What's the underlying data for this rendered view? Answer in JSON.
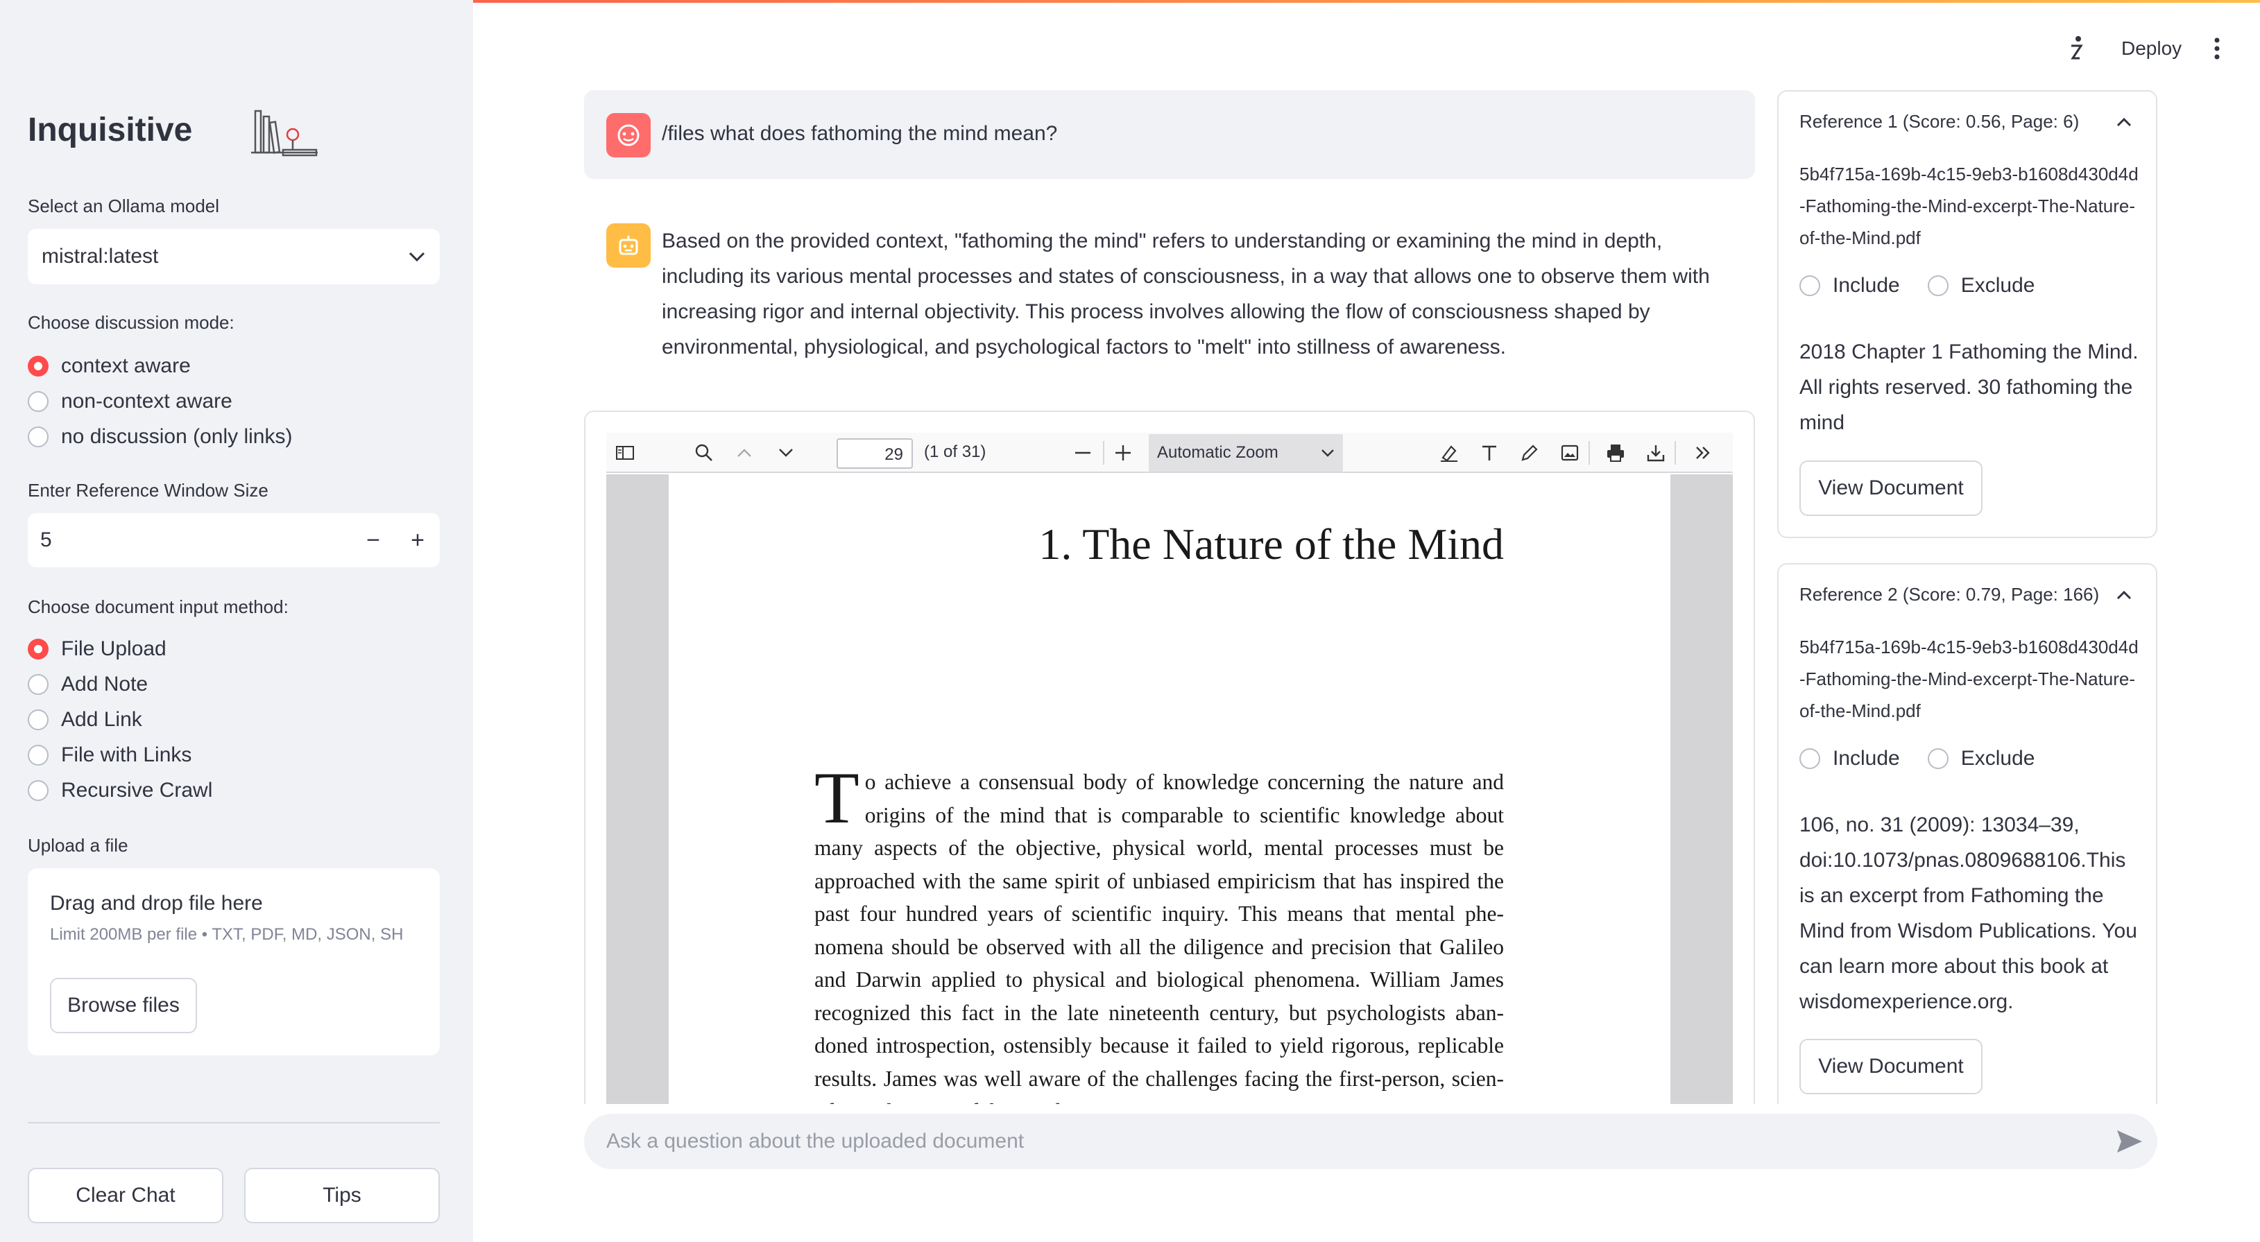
{
  "sidebar": {
    "title": "Inquisitive",
    "model_label": "Select an Ollama model",
    "model_value": "mistral:latest",
    "mode_label": "Choose discussion mode:",
    "modes": [
      {
        "label": "context aware",
        "selected": true
      },
      {
        "label": "non-context aware",
        "selected": false
      },
      {
        "label": "no discussion (only links)",
        "selected": false
      }
    ],
    "window_label": "Enter Reference Window Size",
    "window_value": "5",
    "input_method_label": "Choose document input method:",
    "input_methods": [
      {
        "label": "File Upload",
        "selected": true
      },
      {
        "label": "Add Note",
        "selected": false
      },
      {
        "label": "Add Link",
        "selected": false
      },
      {
        "label": "File with Links",
        "selected": false
      },
      {
        "label": "Recursive Crawl",
        "selected": false
      }
    ],
    "upload_label": "Upload a file",
    "upload_drag": "Drag and drop file here",
    "upload_limit": "Limit 200MB per file • TXT, PDF, MD, JSON, SH",
    "browse_label": "Browse files",
    "clear_label": "Clear Chat",
    "tips_label": "Tips"
  },
  "topbar": {
    "deploy_label": "Deploy"
  },
  "chat": {
    "user_message": "/files what does fathoming the mind mean?",
    "bot_message": "Based on the provided context, \"fathoming the mind\" refers to understanding or examining the mind in depth, including its various mental processes and states of consciousness, in a way that allows one to observe them with increasing rigor and internal objectivity. This process involves allowing the flow of consciousness shaped by environmental, physiological, and psychological factors to \"melt\" into stillness of awareness.",
    "input_placeholder": "Ask a question about the uploaded document"
  },
  "pdf": {
    "page_number": "29",
    "page_of": "(1 of 31)",
    "zoom": "Automatic Zoom",
    "title": "1. The Nature of the Mind",
    "dropcap": "T",
    "body": "o achieve a consensual body of knowledge concerning the nature and origins of the mind that is comparable to scientific knowledge about many aspects of the objective, physical world, mental processes must be approached with the same spirit of unbiased empiricism that has inspired the past four hundred years of scientific inquiry. This means that mental phe-nomena should be observed with all the diligence and precision that Galileo and Darwin applied to physical and biological phenomena. William James recognized this fact in the late nineteenth century, but psychologists aban-doned introspection, ostensibly because it failed to yield rigorous, replicable results. James was well aware of the challenges facing the first-person, scien-tific exploration of the mind."
  },
  "references": [
    {
      "header": "Reference 1 (Score: 0.56, Page: 6)",
      "file": "5b4f715a-169b-4c15-9eb3-b1608d430d4d-Fathoming-the-Mind-excerpt-The-Nature-of-the-Mind.pdf",
      "include": "Include",
      "exclude": "Exclude",
      "text": "2018 Chapter 1 Fathoming the Mind. All rights reserved. 30 fathoming the mind",
      "view": "View Document"
    },
    {
      "header": "Reference 2 (Score: 0.79, Page: 166)",
      "file": "5b4f715a-169b-4c15-9eb3-b1608d430d4d-Fathoming-the-Mind-excerpt-The-Nature-of-the-Mind.pdf",
      "include": "Include",
      "exclude": "Exclude",
      "text": "106, no. 31 (2009): 13034–39, doi:10.1073/pnas.0809688106.This is an excerpt from Fathoming the Mind from Wisdom Publications. You can learn more about this book at wisdomexperience.org.",
      "view": "View Document"
    }
  ],
  "colors": {
    "accent": "#ff4b4b",
    "user_avatar": "#ff6c6c",
    "bot_avatar": "#ffbd45",
    "sidebar_bg": "#f0f2f6"
  }
}
